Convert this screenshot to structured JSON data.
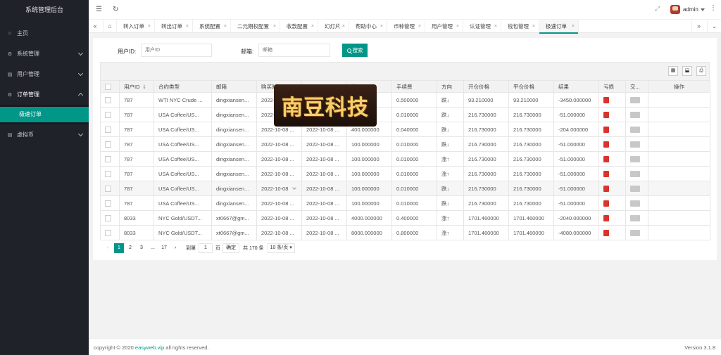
{
  "app": {
    "title": "系统管理后台"
  },
  "sidebar": {
    "items": [
      {
        "label": "主页",
        "icon": "home-icon"
      },
      {
        "label": "系统管理",
        "icon": "gear-icon"
      },
      {
        "label": "用户管理",
        "icon": "users-icon"
      },
      {
        "label": "订单管理",
        "icon": "settings-icon"
      },
      {
        "label": "虚拟币",
        "icon": "coin-icon"
      }
    ],
    "sub_active": "极速订单"
  },
  "header": {
    "user": "admin"
  },
  "tabs": [
    "转入订单",
    "转出订单",
    "系统配置",
    "二元期权配置",
    "收款配置",
    "幻灯片",
    "帮助中心",
    "币种管理",
    "用户管理",
    "认证管理",
    "钱包管理",
    "极速订单"
  ],
  "filters": {
    "user_id_label": "用户ID:",
    "user_id_placeholder": "用户ID",
    "email_label": "邮箱:",
    "email_placeholder": "邮箱",
    "search_label": "搜索"
  },
  "table": {
    "columns": [
      "用户ID",
      "合约类型",
      "邮箱",
      "购买时间",
      "",
      "数量",
      "手续费",
      "方向",
      "开仓价格",
      "平仓价格",
      "结果",
      "亏损",
      "交...",
      "操作"
    ],
    "rows": [
      {
        "uid": "787",
        "type": "WTI NYC Crude ...",
        "email": "dingxiansen...",
        "buy": "2022-10-08 ...",
        "close": "",
        "qty": "...000",
        "fee": "0.500000",
        "dir": "跌↓",
        "dir_type": "down",
        "open": "93.210000",
        "close_price": "93.210000",
        "result": "-3450.000000"
      },
      {
        "uid": "787",
        "type": "USA Coffee/US...",
        "email": "dingxiansen...",
        "buy": "2022-1...",
        "close": "",
        "qty": "...000",
        "fee": "0.010000",
        "dir": "跌↓",
        "dir_type": "down",
        "open": "216.730000",
        "close_price": "216.730000",
        "result": "-51.000000"
      },
      {
        "uid": "787",
        "type": "USA Coffee/US...",
        "email": "dingxiansen...",
        "buy": "2022-10-08 ...",
        "close": "2022-10-08 ...",
        "qty": "400.000000",
        "fee": "0.040000",
        "dir": "跌↓",
        "dir_type": "down",
        "open": "216.730000",
        "close_price": "216.730000",
        "result": "-204.000000"
      },
      {
        "uid": "787",
        "type": "USA Coffee/US...",
        "email": "dingxiansen...",
        "buy": "2022-10-08 ...",
        "close": "2022-10-08 ...",
        "qty": "100.000000",
        "fee": "0.010000",
        "dir": "跌↓",
        "dir_type": "down",
        "open": "216.730000",
        "close_price": "216.730000",
        "result": "-51.000000"
      },
      {
        "uid": "787",
        "type": "USA Coffee/US...",
        "email": "dingxiansen...",
        "buy": "2022-10-08 ...",
        "close": "2022-10-08 ...",
        "qty": "100.000000",
        "fee": "0.010000",
        "dir": "涨↑",
        "dir_type": "up",
        "open": "216.730000",
        "close_price": "216.730000",
        "result": "-51.000000"
      },
      {
        "uid": "787",
        "type": "USA Coffee/US...",
        "email": "dingxiansen...",
        "buy": "2022-10-08 ...",
        "close": "2022-10-08 ...",
        "qty": "100.000000",
        "fee": "0.010000",
        "dir": "涨↑",
        "dir_type": "up",
        "open": "216.730000",
        "close_price": "216.730000",
        "result": "-51.000000"
      },
      {
        "uid": "787",
        "type": "USA Coffee/US...",
        "email": "dingxiansen...",
        "buy": "2022-10-08",
        "close": "2022-10-08 ...",
        "qty": "100.000000",
        "fee": "0.010000",
        "dir": "跌↓",
        "dir_type": "down",
        "open": "216.730000",
        "close_price": "216.730000",
        "result": "-51.000000"
      },
      {
        "uid": "787",
        "type": "USA Coffee/US...",
        "email": "dingxiansen...",
        "buy": "2022-10-08 ...",
        "close": "2022-10-08 ...",
        "qty": "100.000000",
        "fee": "0.010000",
        "dir": "跌↓",
        "dir_type": "down",
        "open": "216.730000",
        "close_price": "216.730000",
        "result": "-51.000000"
      },
      {
        "uid": "8033",
        "type": "NYC Gold/USDT...",
        "email": "xt0667@gm...",
        "buy": "2022-10-08 ...",
        "close": "2022-10-08 ...",
        "qty": "4000.000000",
        "fee": "0.400000",
        "dir": "涨↑",
        "dir_type": "up",
        "open": "1701.460000",
        "close_price": "1701.460000",
        "result": "-2040.000000"
      },
      {
        "uid": "8033",
        "type": "NYC Gold/USDT...",
        "email": "xt0667@gm...",
        "buy": "2022-10-08 ...",
        "close": "2022-10-08 ...",
        "qty": "8000.000000",
        "fee": "0.800000",
        "dir": "涨↑",
        "dir_type": "up",
        "open": "1701.460000",
        "close_price": "1701.460000",
        "result": "-4080.000000"
      }
    ]
  },
  "pager": {
    "pages": [
      "1",
      "2",
      "3",
      "...",
      "17"
    ],
    "goto_label": "到第",
    "goto_value": "1",
    "page_unit": "页",
    "confirm": "确定",
    "total": "共 170 条",
    "per_page": "10 条/页"
  },
  "watermark": {
    "text": "南豆科技"
  },
  "footer": {
    "copyright_prefix": "copyright © 2020 ",
    "copyright_link": "easyweb.vip",
    "copyright_suffix": " all rights reserved.",
    "version": "Version 3.1.8"
  },
  "colors": {
    "accent": "#009688",
    "sidebar_bg": "#20222a",
    "down": "#e54a3a",
    "up": "#2b9c46"
  }
}
